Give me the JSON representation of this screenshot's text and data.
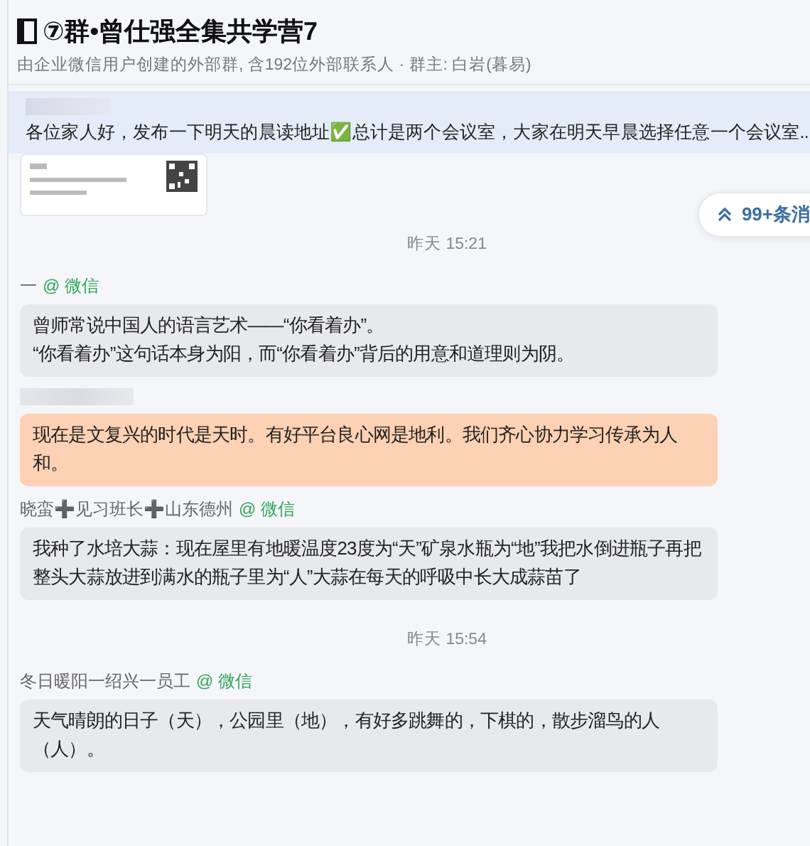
{
  "header": {
    "title": "⑦群•曾仕强全集共学营7",
    "subtitle": "由企业微信用户创建的外部群, 含192位外部联系人 · 群主: 白岩(暮易)"
  },
  "pinned": {
    "text": "各位家人好，发布一下明天的晨读地址✅总计是两个会议室，大家在明天早晨选择任意一个会议室..."
  },
  "unread_button": {
    "label": "99+条消"
  },
  "messages": [
    {
      "kind": "card"
    },
    {
      "kind": "time",
      "text": "昨天 15:21"
    },
    {
      "kind": "message",
      "sender": "一",
      "source": "@ 微信",
      "highlighted": false,
      "text": "曾师常说中国人的语言艺术——“你看着办”。\n“你看着办”这句话本身为阳，而“你看着办”背后的用意和道理则为阴。"
    },
    {
      "kind": "message",
      "sender_blurred": true,
      "highlighted": true,
      "text": "现在是文复兴的时代是天时。有好平台良心网是地利。我们齐心协力学习传承为人和。"
    },
    {
      "kind": "message",
      "sender": "晓蛮➕见习班长➕山东德州",
      "source": "@ 微信",
      "highlighted": false,
      "text": "我种了水培大蒜：现在屋里有地暖温度23度为“天”矿泉水瓶为“地”我把水倒进瓶子再把整头大蒜放进到满水的瓶子里为“人”大蒜在每天的呼吸中长大成蒜苗了"
    },
    {
      "kind": "time",
      "text": "昨天 15:54"
    },
    {
      "kind": "message",
      "sender": "冬日暖阳一绍兴一员工",
      "source": "@ 微信",
      "highlighted": false,
      "text": "天气晴朗的日子（天），公园里（地），有好多跳舞的，下棋的，散步溜鸟的人（人）。"
    }
  ]
}
